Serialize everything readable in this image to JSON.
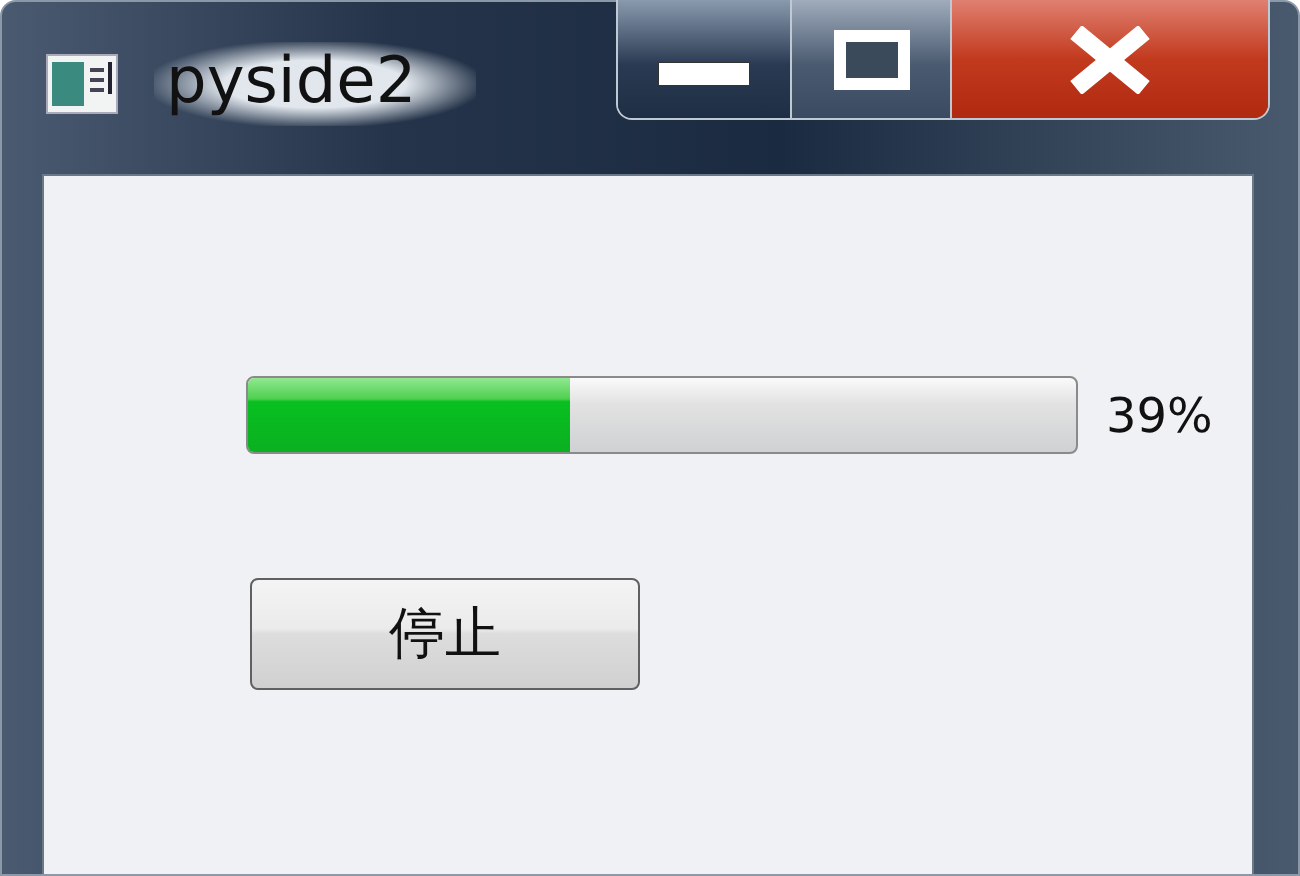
{
  "window": {
    "title": "pyside2"
  },
  "progress": {
    "level": 0.39,
    "reading": "39%"
  },
  "buttons": [
    "停止"
  ]
}
